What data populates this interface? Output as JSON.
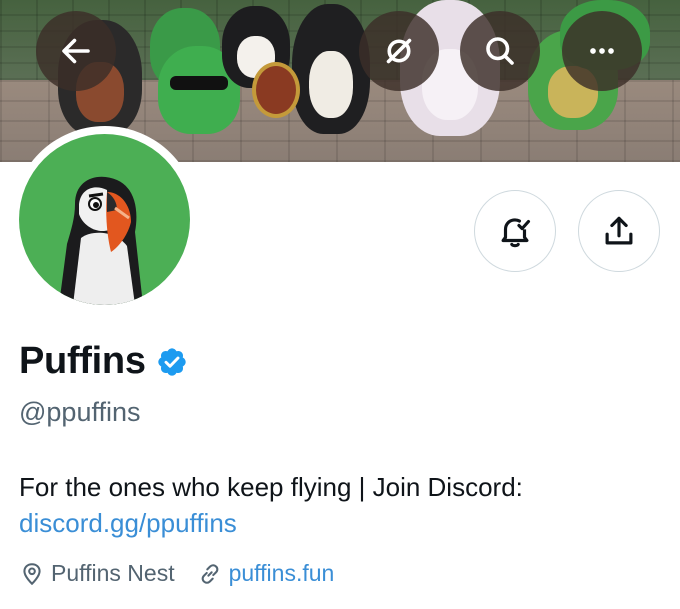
{
  "profile": {
    "display_name": "Puffins",
    "handle": "@ppuffins",
    "verified": true,
    "bio_text": "For the ones who keep flying | Join Discord:",
    "bio_link": "discord.gg/ppuffins",
    "location": "Puffins Nest",
    "website": "puffins.fun"
  },
  "header": {
    "back_icon": "arrow-left-icon",
    "hide_icon": "eye-slash-icon",
    "search_icon": "search-icon",
    "more_icon": "more-horizontal-icon"
  },
  "actions": {
    "notify_icon": "bell-check-icon",
    "share_icon": "share-upload-icon"
  },
  "colors": {
    "link": "#3a8ed6",
    "verified_badge": "#1d9bf0",
    "avatar_bg": "#4caf55",
    "text_primary": "#0f1419",
    "text_secondary": "#536471"
  }
}
